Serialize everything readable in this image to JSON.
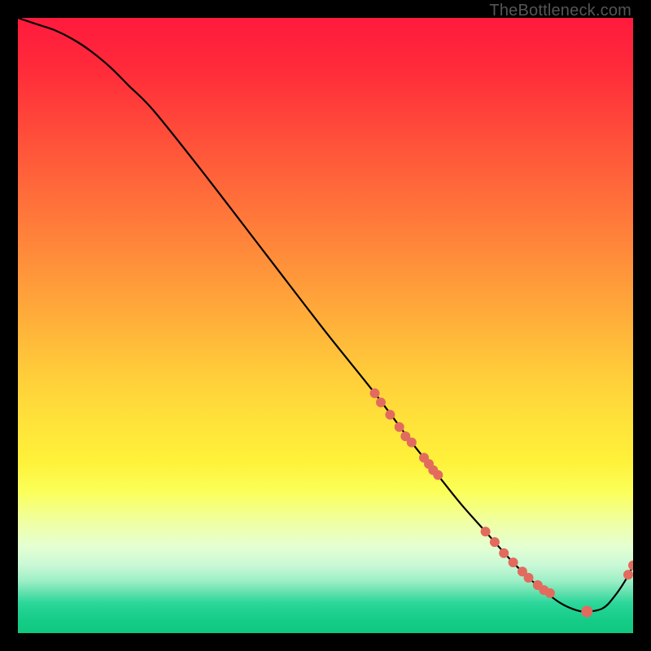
{
  "watermark": "TheBottleneck.com",
  "chart_data": {
    "type": "line",
    "title": "",
    "xlabel": "",
    "ylabel": "",
    "xlim": [
      0,
      100
    ],
    "ylim": [
      0,
      100
    ],
    "curve": {
      "name": "bottleneck-curve",
      "x": [
        0,
        3,
        6,
        9,
        12,
        15,
        18,
        22,
        30,
        40,
        50,
        58,
        64,
        68,
        72,
        76,
        80,
        83,
        86,
        88,
        90,
        92,
        95,
        97,
        99,
        100
      ],
      "y": [
        100,
        99,
        98,
        96.5,
        94.5,
        92,
        89,
        85,
        75,
        62,
        49,
        39,
        31,
        26,
        21,
        16.5,
        12,
        9,
        6.5,
        5,
        4,
        3.5,
        4,
        6,
        9,
        11
      ]
    },
    "points_on_curve": {
      "name": "highlighted-points",
      "x": [
        58,
        59,
        60.5,
        62,
        63,
        64,
        66,
        66.8,
        67.5,
        68.3,
        76,
        77.5,
        79,
        80.5,
        82,
        83,
        84.5,
        85.5,
        86.5,
        92.5,
        99.2,
        100
      ],
      "y": [
        39,
        37.5,
        35.5,
        33.5,
        32,
        31,
        28.5,
        27.5,
        26.5,
        25.7,
        16.5,
        14.8,
        13,
        11.5,
        10,
        9,
        7.8,
        7,
        6.5,
        3.5,
        9.5,
        11
      ],
      "r": [
        6,
        6,
        6,
        6,
        6,
        6,
        6,
        6,
        6,
        6,
        6,
        6,
        6,
        6,
        6,
        6,
        6,
        6,
        6,
        7,
        6,
        6
      ]
    }
  }
}
